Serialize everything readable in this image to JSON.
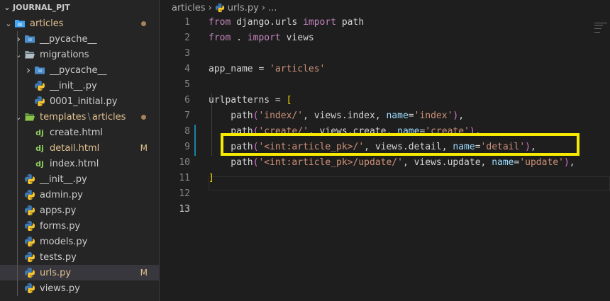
{
  "explorer": {
    "section_title": "JOURNAL_PJT",
    "items": [
      {
        "label": "articles",
        "kind": "folder-open",
        "git": "dot"
      },
      {
        "label": "__pycache__",
        "kind": "folder-closed"
      },
      {
        "label": "migrations",
        "kind": "folder-open"
      },
      {
        "label": "__pycache__",
        "kind": "folder-closed"
      },
      {
        "label": "__init__.py",
        "kind": "python"
      },
      {
        "label": "0001_initial.py",
        "kind": "python"
      },
      {
        "label": "templates",
        "label2": "articles",
        "kind": "folder-open",
        "git": "dot"
      },
      {
        "label": "create.html",
        "kind": "django"
      },
      {
        "label": "detail.html",
        "kind": "django",
        "git": "M"
      },
      {
        "label": "index.html",
        "kind": "django"
      },
      {
        "label": "__init__.py",
        "kind": "python"
      },
      {
        "label": "admin.py",
        "kind": "python"
      },
      {
        "label": "apps.py",
        "kind": "python"
      },
      {
        "label": "forms.py",
        "kind": "python"
      },
      {
        "label": "models.py",
        "kind": "python"
      },
      {
        "label": "tests.py",
        "kind": "python"
      },
      {
        "label": "urls.py",
        "kind": "python",
        "git": "M"
      },
      {
        "label": "views.py",
        "kind": "python"
      }
    ],
    "django_glyph": "dj",
    "modified_badge": "M",
    "path_separator": "\\"
  },
  "breadcrumb": {
    "folder": "articles",
    "file": "urls.py",
    "more": "..."
  },
  "editor": {
    "line_numbers": [
      "1",
      "2",
      "3",
      "4",
      "5",
      "6",
      "7",
      "8",
      "9",
      "10",
      "11",
      "12",
      "13"
    ],
    "lines": [
      {
        "t": [
          [
            "kw",
            "from"
          ],
          [
            "p",
            " django.urls "
          ],
          [
            "kw",
            "import"
          ],
          [
            "p",
            " path"
          ]
        ]
      },
      {
        "t": [
          [
            "kw",
            "from"
          ],
          [
            "p",
            " . "
          ],
          [
            "kw",
            "import"
          ],
          [
            "p",
            " views"
          ]
        ]
      },
      {
        "t": []
      },
      {
        "t": [
          [
            "p",
            "app_name = "
          ],
          [
            "str",
            "'articles'"
          ]
        ]
      },
      {
        "t": []
      },
      {
        "t": [
          [
            "p",
            "urlpatterns = "
          ],
          [
            "bracket",
            "["
          ]
        ]
      },
      {
        "t": [
          [
            "p",
            "    path"
          ],
          [
            "bracket2",
            "("
          ],
          [
            "str",
            "'index/'"
          ],
          [
            "p",
            ", views.index, "
          ],
          [
            "param",
            "name"
          ],
          [
            "p",
            "="
          ],
          [
            "str",
            "'index'"
          ],
          [
            "bracket2",
            ")"
          ],
          [
            "p",
            ","
          ]
        ]
      },
      {
        "t": [
          [
            "p",
            "    path"
          ],
          [
            "bracket2",
            "("
          ],
          [
            "str",
            "'create/'"
          ],
          [
            "p",
            ", views.create, "
          ],
          [
            "param",
            "name"
          ],
          [
            "p",
            "="
          ],
          [
            "str",
            "'create'"
          ],
          [
            "bracket2",
            ")"
          ],
          [
            "p",
            ","
          ]
        ]
      },
      {
        "t": [
          [
            "p",
            "    path"
          ],
          [
            "bracket2",
            "("
          ],
          [
            "str",
            "'<int:article_pk>/'"
          ],
          [
            "p",
            ", views.detail, "
          ],
          [
            "param",
            "name"
          ],
          [
            "p",
            "="
          ],
          [
            "str",
            "'detail'"
          ],
          [
            "bracket2",
            ")"
          ],
          [
            "p",
            ","
          ]
        ]
      },
      {
        "t": [
          [
            "p",
            "    path"
          ],
          [
            "bracket2",
            "("
          ],
          [
            "str",
            "'<int:article_pk>/update/'"
          ],
          [
            "p",
            ", views.update, "
          ],
          [
            "param",
            "name"
          ],
          [
            "p",
            "="
          ],
          [
            "str",
            "'update'"
          ],
          [
            "bracket2",
            ")"
          ],
          [
            "p",
            ","
          ]
        ]
      },
      {
        "t": [
          [
            "bracket",
            "]"
          ]
        ]
      },
      {
        "t": []
      },
      {
        "t": []
      }
    ],
    "active_line": 13,
    "highlighted_line": 10
  },
  "colors": {
    "highlight": "#f6ea00",
    "keyword": "#c586c0",
    "string": "#ce9178",
    "param": "#9cdcfe",
    "modified": "#e2c08d"
  }
}
